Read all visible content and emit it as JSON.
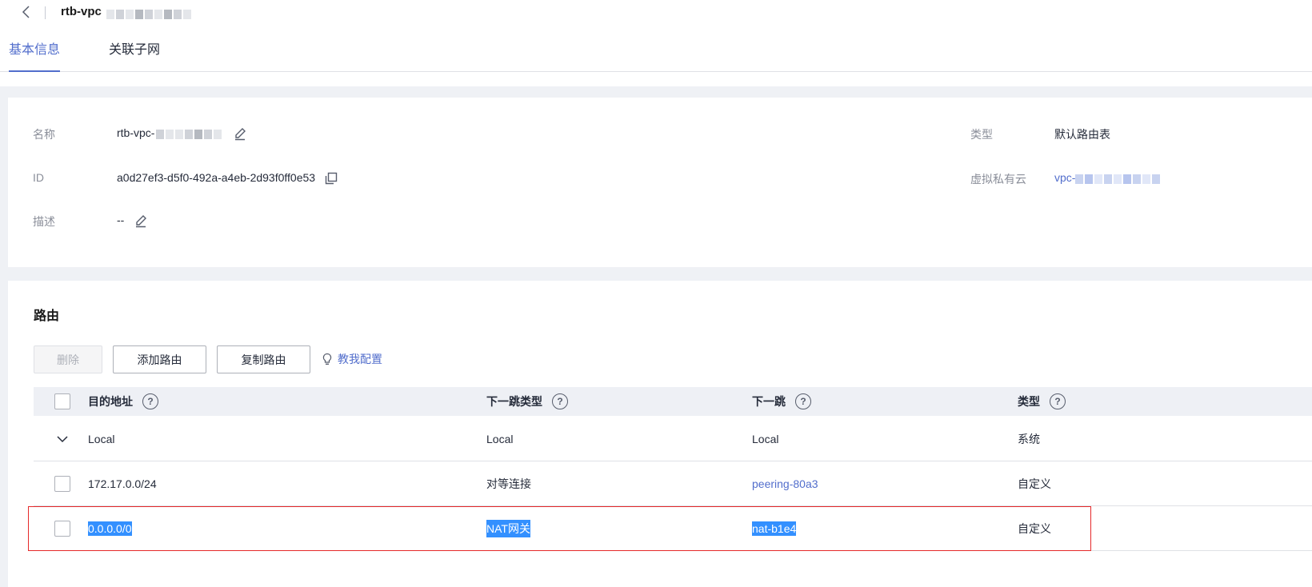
{
  "header": {
    "back_icon": "chevron-left-icon",
    "title": "rtb-vpc"
  },
  "tabs": [
    {
      "label": "基本信息",
      "active": true
    },
    {
      "label": "关联子网",
      "active": false
    }
  ],
  "info": {
    "name_label": "名称",
    "name_value": "rtb-vpc-",
    "id_label": "ID",
    "id_value": "a0d27ef3-d5f0-492a-a4eb-2d93f0ff0e53",
    "desc_label": "描述",
    "desc_value": "--",
    "type_label": "类型",
    "type_value": "默认路由表",
    "vpc_label": "虚拟私有云",
    "vpc_value": "vpc-"
  },
  "routes": {
    "title": "路由",
    "buttons": {
      "delete": "删除",
      "add": "添加路由",
      "copy": "复制路由",
      "guide": "教我配置"
    },
    "columns": [
      "目的地址",
      "下一跳类型",
      "下一跳",
      "类型"
    ],
    "rows": [
      {
        "dest": "Local",
        "hop_type": "Local",
        "hop": "Local",
        "type": "系统"
      },
      {
        "dest": "172.17.0.0/24",
        "hop_type": "对等连接",
        "hop": "peering-80a3",
        "type": "自定义"
      },
      {
        "dest": "0.0.0.0/0",
        "hop_type": "NAT网关",
        "hop": "nat-b1e4",
        "type": "自定义"
      }
    ]
  },
  "colors": {
    "accent": "#526ecc",
    "selection": "#3390ff",
    "highlight_border": "#e5292a"
  }
}
